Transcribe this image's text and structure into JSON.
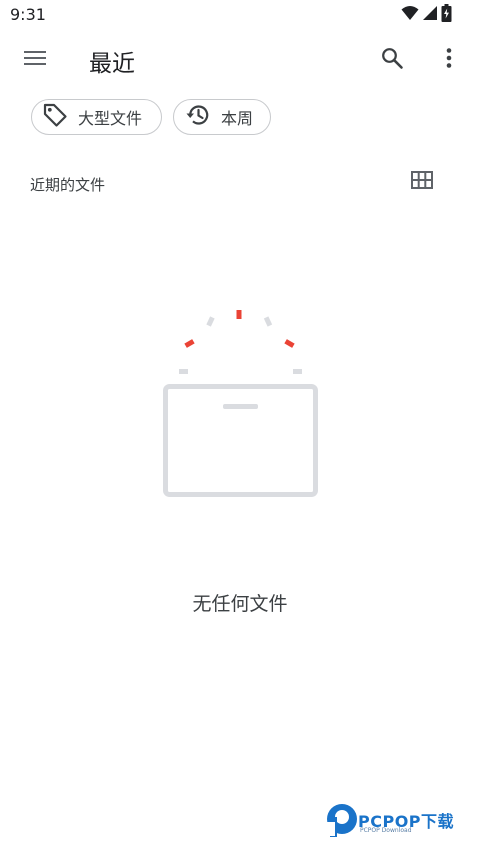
{
  "status_bar": {
    "time": "9:31"
  },
  "app_bar": {
    "title": "最近",
    "icons": [
      "menu-icon",
      "search-icon",
      "more-vert-icon"
    ]
  },
  "chips": [
    {
      "label": "大型文件",
      "icon": "label-tag-icon"
    },
    {
      "label": "本周",
      "icon": "history-icon"
    }
  ],
  "section": {
    "title": "近期的文件",
    "view_icon": "grid-view-icon"
  },
  "empty_state": {
    "message": "无任何文件"
  },
  "watermark": {
    "brand": "PCPOP下载",
    "sub": "PCPOP Download"
  },
  "colors": {
    "text_primary": "#202124",
    "chip_border": "#c8cacd",
    "illustration_gray": "#dadce0",
    "illustration_red": "#ea4335",
    "watermark_blue": "#1a73c9"
  }
}
